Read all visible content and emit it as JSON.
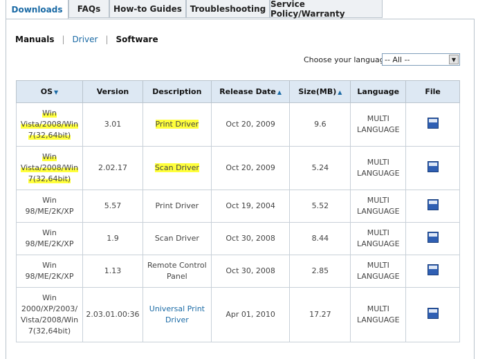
{
  "tabs": [
    {
      "label": "Downloads",
      "active": true
    },
    {
      "label": "FAQs"
    },
    {
      "label": "How-to Guides"
    },
    {
      "label": "Troubleshooting"
    },
    {
      "label": "Service Policy/Warranty"
    }
  ],
  "subnav": {
    "manuals": "Manuals",
    "separator": "|",
    "driver": "Driver",
    "software": "Software"
  },
  "language": {
    "label": "Choose your language",
    "selected": "-- All --"
  },
  "table": {
    "headers": {
      "os": "OS",
      "version": "Version",
      "description": "Description",
      "release_date": "Release Date",
      "size": "Size(MB)",
      "language": "Language",
      "file": "File"
    },
    "rows": [
      {
        "os": "Win Vista/2008/Win 7(32,64bit)",
        "version": "3.01",
        "description": "Print Driver",
        "release_date": "Oct 20, 2009",
        "size": "9.6",
        "language": "MULTI LANGUAGE"
      },
      {
        "os": "Win Vista/2008/Win 7(32,64bit)",
        "version": "2.02.17",
        "description": "Scan Driver",
        "release_date": "Oct 20, 2009",
        "size": "5.24",
        "language": "MULTI LANGUAGE"
      },
      {
        "os": "Win 98/ME/2K/XP",
        "version": "5.57",
        "description": "Print Driver",
        "release_date": "Oct 19, 2004",
        "size": "5.52",
        "language": "MULTI LANGUAGE"
      },
      {
        "os": "Win 98/ME/2K/XP",
        "version": "1.9",
        "description": "Scan Driver",
        "release_date": "Oct 30, 2008",
        "size": "8.44",
        "language": "MULTI LANGUAGE"
      },
      {
        "os": "Win 98/ME/2K/XP",
        "version": "1.13",
        "description": "Remote Control Panel",
        "release_date": "Oct 30, 2008",
        "size": "2.85",
        "language": "MULTI LANGUAGE"
      },
      {
        "os": "Win 2000/XP/2003/ Vista/2008/Win 7(32,64bit)",
        "version": "2.03.01.00:36",
        "description": "Universal Print Driver",
        "release_date": "Apr 01, 2010",
        "size": "17.27",
        "language": "MULTI LANGUAGE"
      }
    ]
  },
  "icons": {
    "sort_down": "sort-down-icon",
    "sort_up": "sort-up-icon",
    "file": "exe-file-icon",
    "dropdown": "chevron-down-icon"
  },
  "colors": {
    "accent": "#1a6aa5",
    "header_bg": "#dde8f3",
    "highlight": "#ffff3c"
  }
}
